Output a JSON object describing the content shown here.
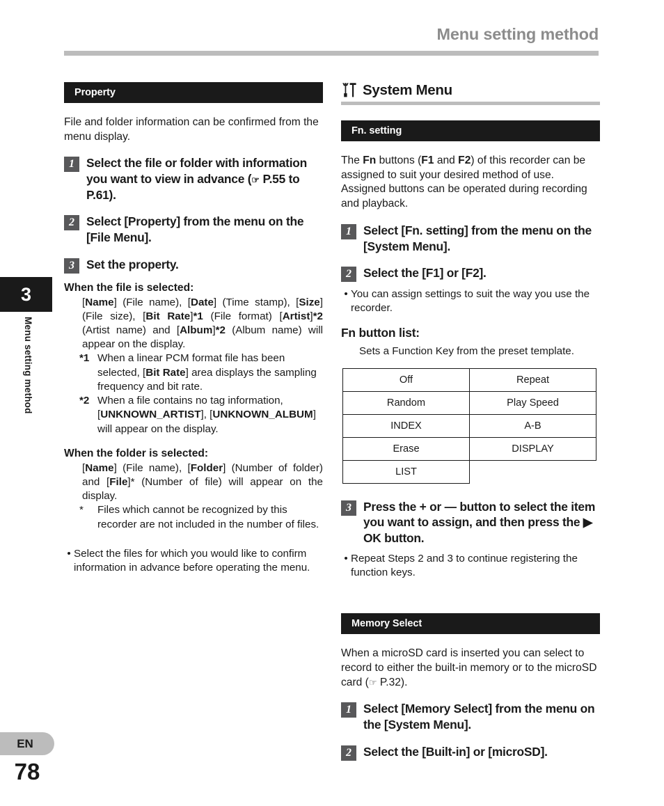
{
  "header": {
    "title": "Menu setting method"
  },
  "chapter": {
    "number": "3",
    "label": "Menu setting method"
  },
  "footer": {
    "language": "EN",
    "page_number": "78"
  },
  "left_column": {
    "section_title": "Property",
    "intro": "File and folder information can be confirmed from the menu display.",
    "steps": [
      {
        "num": "1",
        "text_html": "Select the file or folder with information you want to view in advance (<span class=\"hand\">☞</span> P.55 to P.61)."
      },
      {
        "num": "2",
        "text_html": "Select [<b>Property</b>] from the menu on the [<b>File Menu</b>]."
      },
      {
        "num": "3",
        "text_html": "Set the property."
      }
    ],
    "file_block": {
      "heading": "When the file is selected:",
      "body_html": "[<b>Name</b>] (File name), [<b>Date</b>] (Time stamp), [<b>Size</b>] (File size), [<b>Bit Rate</b>]<b>*1</b> (File format) [<b>Artist</b>]<b>*2</b> (Artist name) and [<b>Album</b>]<b>*2</b> (Album name) will appear on the display.",
      "footnotes": [
        {
          "mark": "*1",
          "body_html": "When a linear PCM format file has been selected, [<b>Bit Rate</b>] area displays the sampling frequency and bit rate."
        },
        {
          "mark": "*2",
          "body_html": "When a file contains no tag information, [<b>UNKNOWN_ARTIST</b>], [<b>UNKNOWN_ALBUM</b>] will appear on the display."
        }
      ]
    },
    "folder_block": {
      "heading": "When the folder is selected:",
      "body_html": "[<b>Name</b>] (File name), [<b>Folder</b>] (Number of folder) and [<b>File</b>]* (Number of file) will appear on the display.",
      "footnotes": [
        {
          "mark": "*",
          "body_html": "Files which cannot be recognized by this recorder are not included in the number of files."
        }
      ]
    },
    "note": "Select the files for which you would like to confirm information in advance before operating the menu."
  },
  "right_column": {
    "menu_heading": {
      "icon": "tools-icon",
      "title": "System Menu"
    },
    "fn_setting": {
      "section_title": "Fn. setting",
      "intro_html": "The <b>Fn</b> buttons (<b>F1</b> and <b>F2</b>) of this recorder can be assigned to suit your desired method of use. Assigned buttons can be operated during recording and playback.",
      "steps": [
        {
          "num": "1",
          "text_html": "Select [<b>Fn. setting</b>] from the menu on the [<b>System Menu</b>]."
        },
        {
          "num": "2",
          "text_html": "Select the [<b>F1</b>] or [<b>F2</b>]."
        }
      ],
      "note_after_step2": "You can assign settings to suit the way you use the recorder.",
      "list_heading": "Fn button list:",
      "list_intro": "Sets a Function Key from the preset template.",
      "table": {
        "rows": [
          [
            "Off",
            "Repeat"
          ],
          [
            "Random",
            "Play Speed"
          ],
          [
            "INDEX",
            "A-B"
          ],
          [
            "Erase",
            "DISPLAY"
          ],
          [
            "LIST",
            ""
          ]
        ]
      },
      "step3": {
        "num": "3",
        "text_html": "Press the + or — button to select the item you want to assign, and then press the ▶ <b>OK</b> button."
      },
      "note_after_step3": "Repeat Steps 2 and 3 to continue registering the function keys."
    },
    "memory_select": {
      "section_title": "Memory Select",
      "intro_html": "When a microSD card is inserted you can select to record to either the built-in memory or to the microSD card (<span class=\"hand\">☞</span> P.32).",
      "steps": [
        {
          "num": "1",
          "text_html": "Select [<b>Memory Select</b>] from the menu on the [<b>System Menu</b>]."
        },
        {
          "num": "2",
          "text_html": "Select the [<b>Built-in</b>] or [<b>microSD</b>]."
        }
      ]
    }
  }
}
